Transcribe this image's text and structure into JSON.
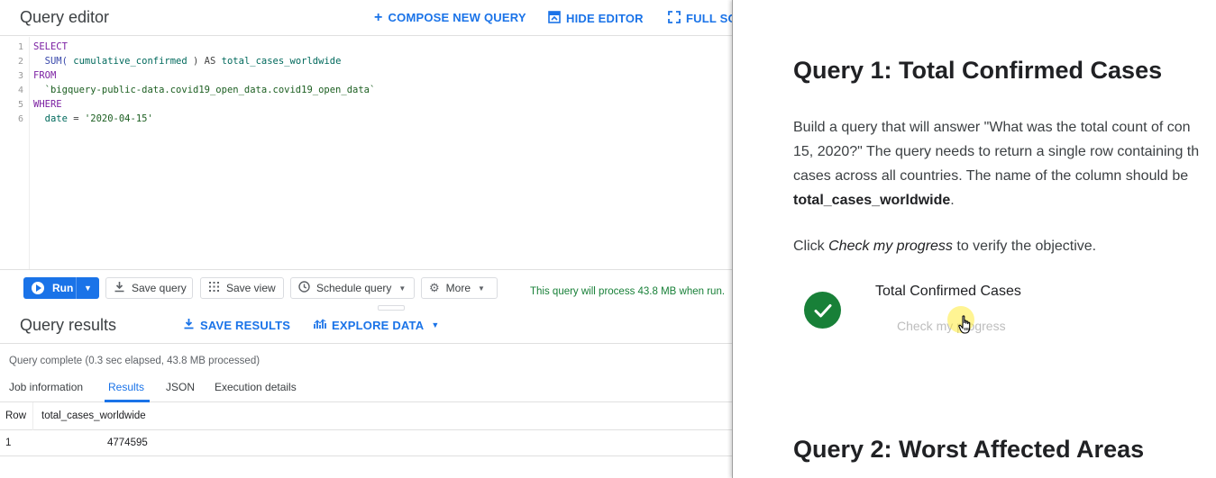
{
  "editor": {
    "title": "Query editor",
    "compose_label": "COMPOSE NEW QUERY",
    "hide_label": "HIDE EDITOR",
    "full_label": "FULL SC",
    "line_numbers": [
      "1",
      "2",
      "3",
      "4",
      "5",
      "6"
    ],
    "code": {
      "l1_kw": "SELECT",
      "l2_fn": "SUM(",
      "l2_arg": " cumulative_confirmed ",
      "l2_close": ")",
      "l2_as": " AS ",
      "l2_alias": "total_cases_worldwide",
      "l3_kw": "FROM",
      "l4_table": "`bigquery-public-data.covid19_open_data.covid19_open_data`",
      "l5_kw": "WHERE",
      "l6_col": "date",
      "l6_op": " = ",
      "l6_val": "'2020-04-15'"
    }
  },
  "toolbar": {
    "run_label": "Run",
    "save_query_label": "Save query",
    "save_view_label": "Save view",
    "schedule_label": "Schedule query",
    "more_label": "More",
    "process_message": "This query will process 43.8 MB when run."
  },
  "results": {
    "title": "Query results",
    "save_label": "SAVE RESULTS",
    "explore_label": "EXPLORE DATA",
    "status": "Query complete (0.3 sec elapsed, 43.8 MB processed)",
    "tabs": [
      "Job information",
      "Results",
      "JSON",
      "Execution details"
    ],
    "columns": [
      "Row",
      "total_cases_worldwide"
    ],
    "rows": [
      [
        "1",
        "4774595"
      ]
    ]
  },
  "lab": {
    "q1_heading": "Query 1: Total Confirmed Cases",
    "p_line1": "Build a query that will answer \"What was the total count of con",
    "p_line2": "15, 2020?\" The query needs to return a single row containing th",
    "p_line3": "cases across all countries. The name of the column should be",
    "p_line4_bold": "total_cases_worldwide",
    "p_line4_rest": ".",
    "click_prefix": "Click ",
    "click_italic": "Check my progress",
    "click_suffix": " to verify the objective.",
    "checkpoint_title": "Total Confirmed Cases",
    "check_button": "Check my progress",
    "q2_heading": "Query 2: Worst Affected Areas"
  },
  "colors": {
    "accent": "#1a73e8",
    "success": "#188038"
  },
  "icons": [
    "plus-icon",
    "hide-editor-icon",
    "fullscreen-icon",
    "play-icon",
    "save-icon",
    "grid-icon",
    "clock-icon",
    "gear-icon",
    "download-icon",
    "chart-icon",
    "check-icon",
    "hand-cursor-icon"
  ]
}
